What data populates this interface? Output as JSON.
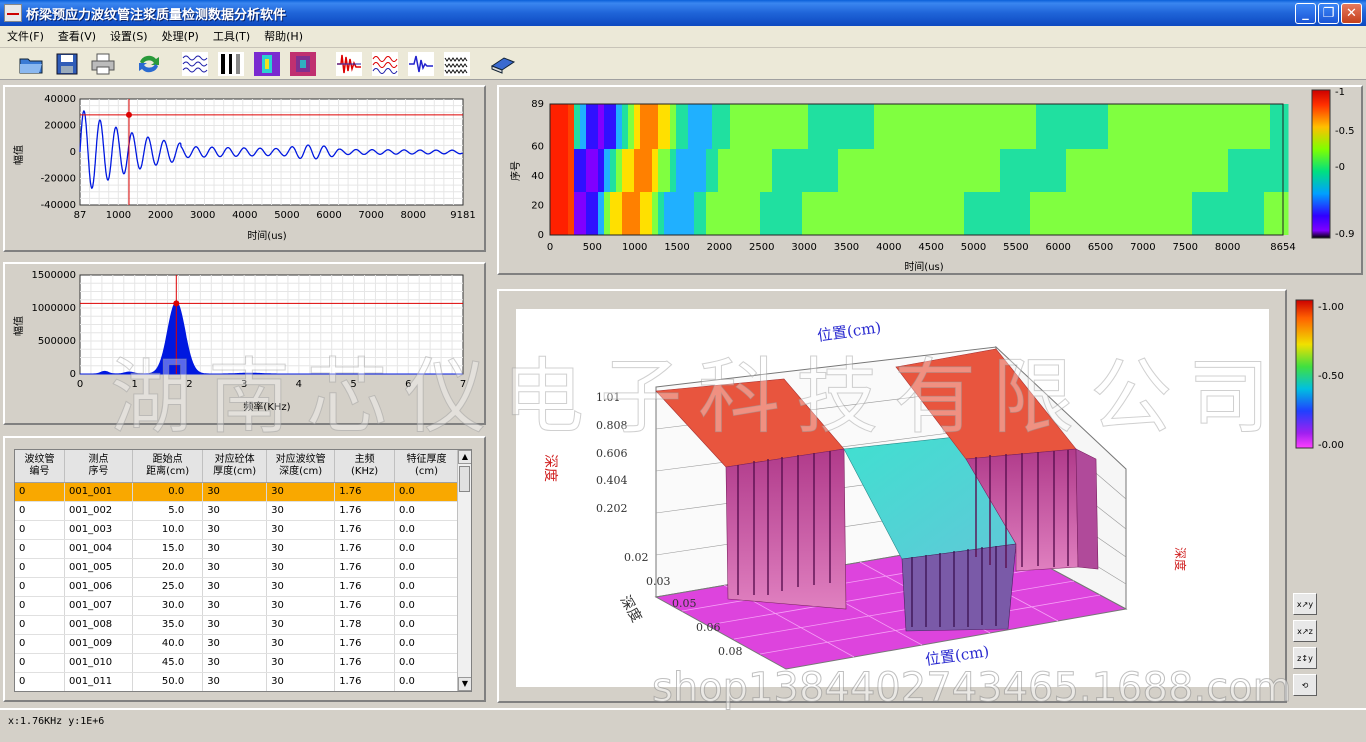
{
  "window": {
    "title": "桥梁预应力波纹管注浆质量检测数据分析软件"
  },
  "menu": [
    {
      "label": "文件(F)"
    },
    {
      "label": "查看(V)"
    },
    {
      "label": "设置(S)"
    },
    {
      "label": "处理(P)"
    },
    {
      "label": "工具(T)"
    },
    {
      "label": "帮助(H)"
    }
  ],
  "toolbar": [
    "open-folder-icon",
    "save-disk-icon",
    "print-icon",
    "refresh-icon",
    "waveform-raw-icon",
    "waveform-dual-icon",
    "color-map-icon",
    "color-map-3d-icon",
    "waveform-red-icon",
    "waveform-multi-icon",
    "spectrum-icon",
    "waveform-dense-icon",
    "book-icon"
  ],
  "time_chart": {
    "ylabel": "幅值",
    "xlabel": "时间(us)",
    "yticks": [
      "40000",
      "20000",
      "0",
      "-20000",
      "-40000"
    ],
    "xticks": [
      "87",
      "1000",
      "2000",
      "3000",
      "4000",
      "5000",
      "6000",
      "7000",
      "8000",
      "9181"
    ],
    "cursor_x": 1250,
    "cursor_y": 28000
  },
  "freq_chart": {
    "ylabel": "幅值",
    "xlabel": "频率(KHz)",
    "yticks": [
      "1500000",
      "1000000",
      "500000",
      "0"
    ],
    "xticks": [
      "0",
      "1",
      "2",
      "3",
      "4",
      "5",
      "6",
      "7"
    ],
    "cursor_x": 1.76,
    "cursor_y": 1070000
  },
  "intensity_chart": {
    "ylabel": "序号",
    "xlabel": "时间(us)",
    "yticks": [
      "89",
      "60",
      "40",
      "20",
      "0"
    ],
    "xticks": [
      "0",
      "500",
      "1000",
      "1500",
      "2000",
      "2500",
      "3000",
      "3500",
      "4000",
      "4500",
      "5000",
      "5500",
      "6000",
      "6500",
      "7000",
      "7500",
      "8000",
      "8654"
    ],
    "scale": [
      "-1",
      "-0.5",
      "-0",
      "-0.9"
    ]
  },
  "surface_chart": {
    "top_label": "位置(cm)",
    "bottom_label": "位置(cm)",
    "z_label": "深度",
    "depth_label": "深度",
    "right_label": "深度",
    "z_ticks": [
      "1.01",
      "0.808",
      "0.606",
      "0.404",
      "0.202"
    ],
    "depth_ticks": [
      "0.02",
      "0.03",
      "0.05",
      "0.06",
      "0.08"
    ],
    "scale": [
      "1.00",
      "0.50",
      "0.00"
    ]
  },
  "table": {
    "headers": [
      [
        "波纹管",
        "编号"
      ],
      [
        "测点",
        "序号"
      ],
      [
        "距始点",
        "距离(cm)"
      ],
      [
        "对应砼体",
        "厚度(cm)"
      ],
      [
        "对应波纹管",
        "深度(cm)"
      ],
      [
        "主频",
        "(KHz)"
      ],
      [
        "特征厚度",
        "(cm)"
      ]
    ],
    "rows": [
      [
        "0",
        "001_001",
        "0.0",
        "30",
        "30",
        "1.76",
        "0.0"
      ],
      [
        "0",
        "001_002",
        "5.0",
        "30",
        "30",
        "1.76",
        "0.0"
      ],
      [
        "0",
        "001_003",
        "10.0",
        "30",
        "30",
        "1.76",
        "0.0"
      ],
      [
        "0",
        "001_004",
        "15.0",
        "30",
        "30",
        "1.76",
        "0.0"
      ],
      [
        "0",
        "001_005",
        "20.0",
        "30",
        "30",
        "1.76",
        "0.0"
      ],
      [
        "0",
        "001_006",
        "25.0",
        "30",
        "30",
        "1.76",
        "0.0"
      ],
      [
        "0",
        "001_007",
        "30.0",
        "30",
        "30",
        "1.76",
        "0.0"
      ],
      [
        "0",
        "001_008",
        "35.0",
        "30",
        "30",
        "1.78",
        "0.0"
      ],
      [
        "0",
        "001_009",
        "40.0",
        "30",
        "30",
        "1.76",
        "0.0"
      ],
      [
        "0",
        "001_010",
        "45.0",
        "30",
        "30",
        "1.76",
        "0.0"
      ],
      [
        "0",
        "001_011",
        "50.0",
        "30",
        "30",
        "1.76",
        "0.0"
      ]
    ]
  },
  "side_buttons": [
    "xy-view-icon",
    "xz-view-icon",
    "zy-view-icon",
    "rotate-view-icon"
  ],
  "status": {
    "text": "x:1.76KHz y:1E+6"
  },
  "watermark": {
    "company": "湖南芯仪电子科技有限公司",
    "shop": "shop1384402743465.1688.com"
  }
}
